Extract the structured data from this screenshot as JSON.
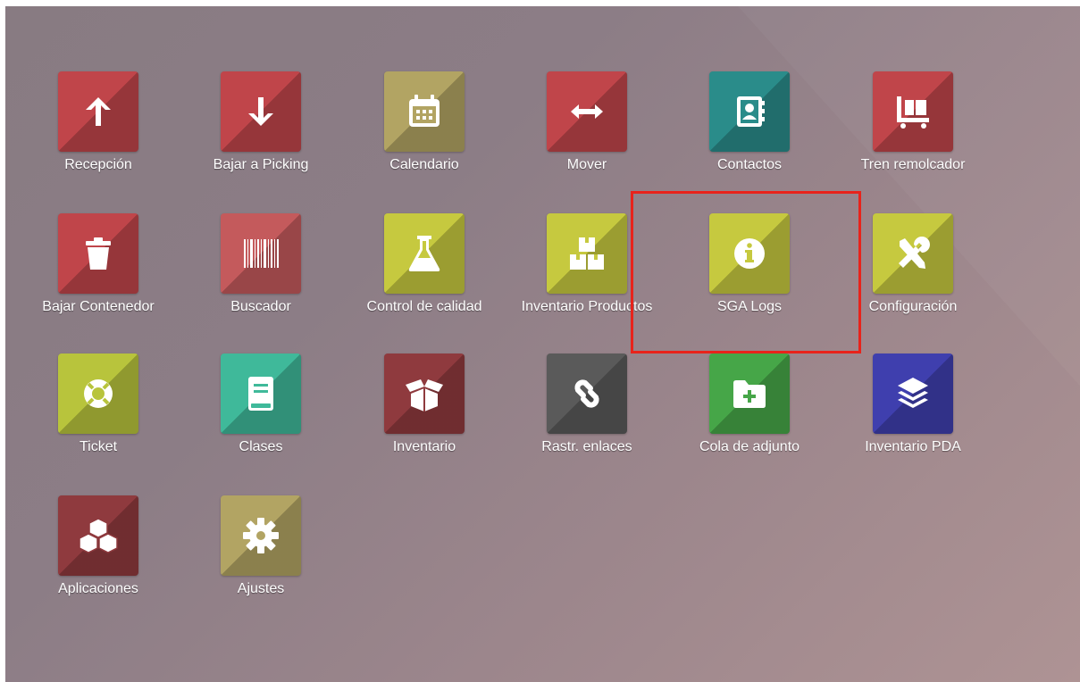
{
  "apps": [
    {
      "label": "Recepción",
      "icon": "arrow-up-icon",
      "color": "#c0454a"
    },
    {
      "label": "Bajar a Picking",
      "icon": "arrow-down-icon",
      "color": "#c0454a"
    },
    {
      "label": "Calendario",
      "icon": "calendar-icon",
      "color": "#b2a463"
    },
    {
      "label": "Mover",
      "icon": "arrows-horizontal-icon",
      "color": "#c0454a"
    },
    {
      "label": "Contactos",
      "icon": "address-book-icon",
      "color": "#2a8c8a"
    },
    {
      "label": "Tren remolcador",
      "icon": "dolly-icon",
      "color": "#c0454a"
    },
    {
      "label": "Bajar Contenedor",
      "icon": "trash-icon",
      "color": "#c0454a"
    },
    {
      "label": "Buscador",
      "icon": "barcode-icon",
      "color": "#c45a5c"
    },
    {
      "label": "Control de calidad",
      "icon": "flask-icon",
      "color": "#c6c93f"
    },
    {
      "label": "Inventario Productos",
      "icon": "boxes-icon",
      "color": "#c6c93f"
    },
    {
      "label": "SGA Logs",
      "icon": "info-circle-icon",
      "color": "#c6c93f"
    },
    {
      "label": "Configuración",
      "icon": "tools-icon",
      "color": "#c6c93f"
    },
    {
      "label": "Ticket",
      "icon": "life-ring-icon",
      "color": "#b8c43c"
    },
    {
      "label": "Clases",
      "icon": "book-icon",
      "color": "#3fb99a"
    },
    {
      "label": "Inventario",
      "icon": "open-box-icon",
      "color": "#8f3a3e"
    },
    {
      "label": "Rastr. enlaces",
      "icon": "link-icon",
      "color": "#5a5a5a"
    },
    {
      "label": "Cola de adjunto",
      "icon": "folder-plus-icon",
      "color": "#46a648"
    },
    {
      "label": "Inventario PDA",
      "icon": "layers-icon",
      "color": "#3f3fae"
    },
    {
      "label": "Aplicaciones",
      "icon": "cubes-icon",
      "color": "#8f3a3e"
    },
    {
      "label": "Ajustes",
      "icon": "gear-icon",
      "color": "#b2a463"
    }
  ],
  "highlight_color": "#e8231b"
}
